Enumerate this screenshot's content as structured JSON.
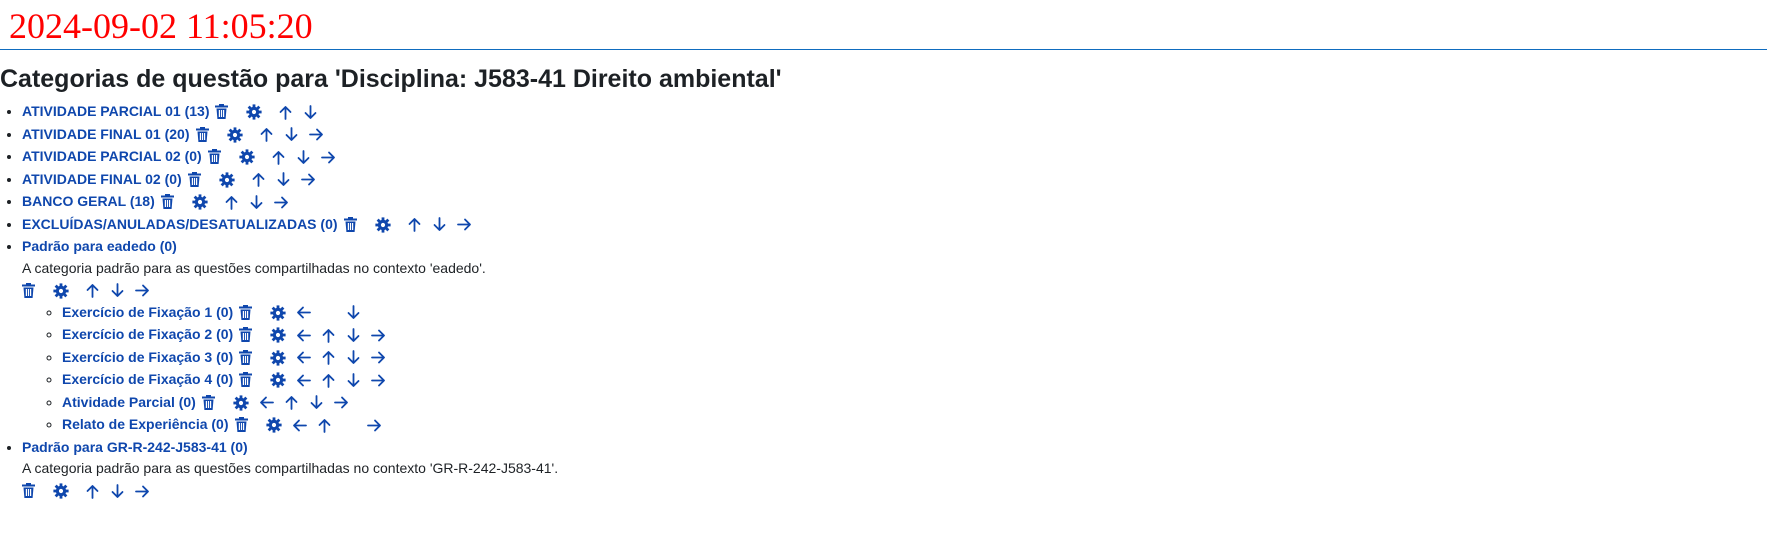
{
  "header": {
    "timestamp": "2024-09-02 11:05:20"
  },
  "page_title": "Categorias de questão para 'Disciplina: J583-41 Direito ambiental'",
  "icons": {
    "delete": "trash-icon",
    "edit": "gear-icon",
    "up": "arrow-up-icon",
    "down": "arrow-down-icon",
    "left": "arrow-left-icon",
    "right": "arrow-right-icon"
  },
  "colors": {
    "link": "#0f47ad",
    "timestamp": "#ff0000",
    "rule": "#0f6cbf"
  },
  "categories": [
    {
      "label": "ATIVIDADE PARCIAL 01 (13)"
    },
    {
      "label": "ATIVIDADE FINAL 01 (20)"
    },
    {
      "label": "ATIVIDADE PARCIAL 02 (0)"
    },
    {
      "label": "ATIVIDADE FINAL 02 (0)"
    },
    {
      "label": "BANCO GERAL (18)"
    },
    {
      "label": "EXCLUÍDAS/ANULADAS/DESATUALIZADAS (0)"
    },
    {
      "label": "Padrão para eadedo (0)",
      "description": "A categoria padrão para as questões compartilhadas no contexto 'eadedo'.",
      "children": [
        {
          "label": "Exercício de Fixação 1 (0)"
        },
        {
          "label": "Exercício de Fixação 2 (0)"
        },
        {
          "label": "Exercício de Fixação 3 (0)"
        },
        {
          "label": "Exercício de Fixação 4 (0)"
        },
        {
          "label": "Atividade Parcial (0)"
        },
        {
          "label": "Relato de Experiência (0)"
        }
      ]
    },
    {
      "label": "Padrão para GR-R-242-J583-41 (0)",
      "description": "A categoria padrão para as questões compartilhadas no contexto 'GR-R-242-J583-41'."
    }
  ]
}
